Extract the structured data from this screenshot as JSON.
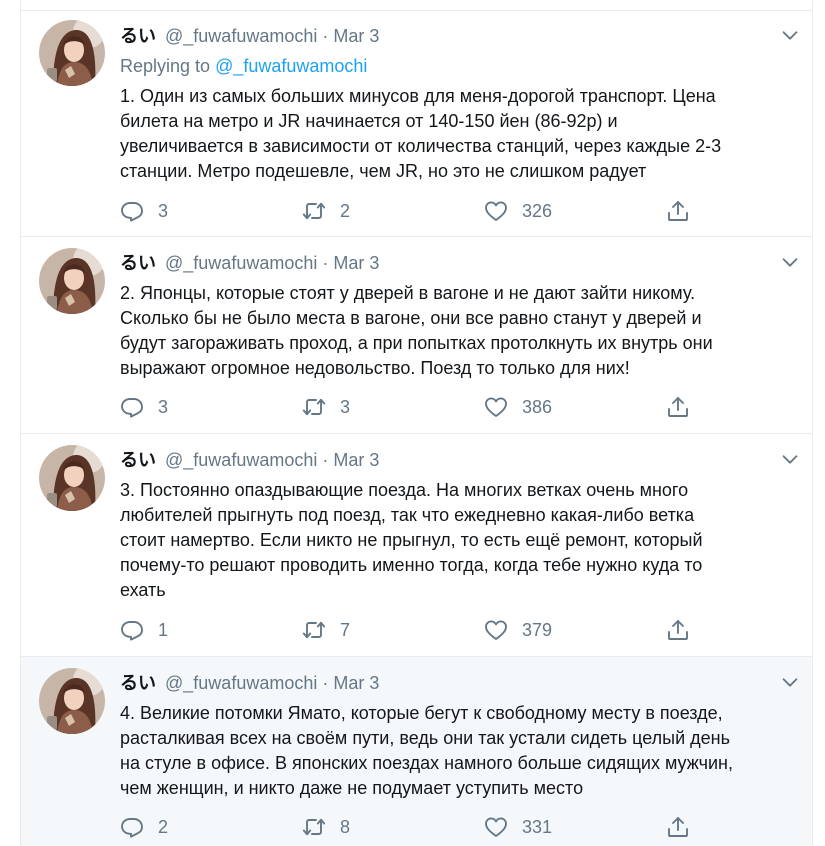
{
  "colors": {
    "text": "#14171a",
    "muted": "#657786",
    "link": "#1da1f2",
    "border": "#e6ecf0",
    "highlight_bg": "#f5f8fa"
  },
  "tweets": [
    {
      "name": "るい",
      "handle": "@_fuwafuwamochi",
      "separator": "·",
      "date": "Mar 3",
      "reply_prefix": "Replying to",
      "reply_handle": "@_fuwafuwamochi",
      "text": "1. Один из самых больших минусов для меня-дорогой транспорт. Цена\nбилета на метро и JR начинается от 140-150 йен (86-92р) и\nувеличивается в зависимости от количества станций, через каждые 2-3\nстанции. Метро подешевле, чем JR, но это не слишком радует",
      "replies": "3",
      "retweets": "2",
      "likes": "326",
      "icons": [
        "reply-icon",
        "retweet-icon",
        "like-icon",
        "share-icon",
        "chevron-down-icon"
      ]
    },
    {
      "name": "るい",
      "handle": "@_fuwafuwamochi",
      "separator": "·",
      "date": "Mar 3",
      "text": "2. Японцы, которые стоят у дверей в вагоне и не дают зайти никому.\nСколько бы не было места в вагоне, они все равно станут у дверей и\nбудут загораживать проход, а при попытках протолкнуть их внутрь они\nвыражают огромное недовольство. Поезд то только для них!",
      "replies": "3",
      "retweets": "3",
      "likes": "386"
    },
    {
      "name": "るい",
      "handle": "@_fuwafuwamochi",
      "separator": "·",
      "date": "Mar 3",
      "text": "3. Постоянно опаздывающие поезда. На многих ветках очень много\nлюбителей прыгнуть под поезд, так что ежедневно какая-либо ветка\nстоит намертво. Если никто не прыгнул, то есть ещё ремонт, который\nпочему-то решают проводить именно тогда, когда тебе нужно куда то\nехать",
      "replies": "1",
      "retweets": "7",
      "likes": "379"
    },
    {
      "name": "るい",
      "handle": "@_fuwafuwamochi",
      "separator": "·",
      "date": "Mar 3",
      "text": "4. Великие потомки Ямато, которые бегут к свободному месту в поезде,\nрасталкивая всех на своём пути, ведь они так устали сидеть целый день\nна стуле в офисе. В японских поездах намного больше сидящих мужчин,\nчем женщин, и никто даже не подумает уступить место",
      "replies": "2",
      "retweets": "8",
      "likes": "331"
    }
  ]
}
